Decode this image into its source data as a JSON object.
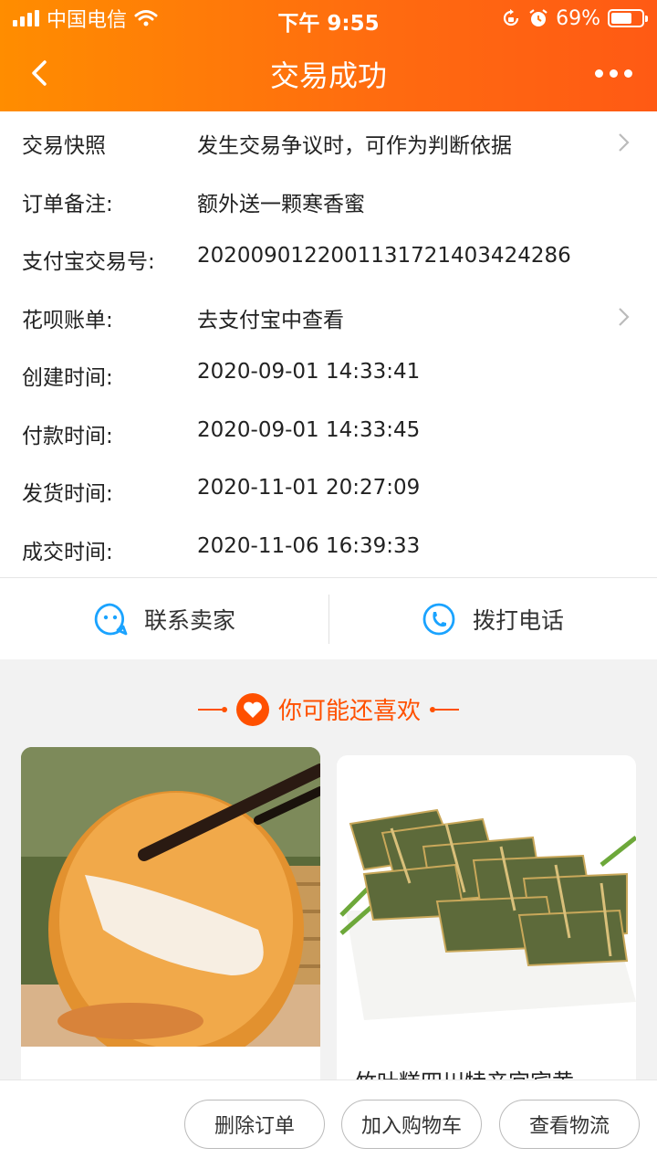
{
  "status_bar": {
    "carrier": "中国电信",
    "time": "下午 9:55",
    "battery_percent": "69%",
    "battery_level": 0.69,
    "icons": [
      "signal-icon",
      "wifi-icon",
      "lock-rotation-icon",
      "alarm-icon",
      "battery-icon"
    ]
  },
  "nav": {
    "title": "交易成功",
    "back_icon": "chevron-left-icon",
    "more_icon": "more-dots-icon"
  },
  "order_info": [
    {
      "label": "交易快照",
      "value": "发生交易争议时，可作为判断依据",
      "has_chevron": true
    },
    {
      "label": "订单备注:",
      "value": "额外送一颗寒香蜜",
      "has_chevron": false
    },
    {
      "label": "支付宝交易号:",
      "value": "2020090122001131721403424286",
      "has_chevron": false
    },
    {
      "label": "花呗账单:",
      "value": "去支付宝中查看",
      "has_chevron": true
    },
    {
      "label": "创建时间:",
      "value": "2020-09-01 14:33:41",
      "has_chevron": false
    },
    {
      "label": "付款时间:",
      "value": "2020-09-01 14:33:45",
      "has_chevron": false
    },
    {
      "label": "发货时间:",
      "value": "2020-11-01 20:27:09",
      "has_chevron": false
    },
    {
      "label": "成交时间:",
      "value": "2020-11-06 16:39:33",
      "has_chevron": false
    }
  ],
  "contact": {
    "seller_label": "联系卖家",
    "call_label": "拨打电话"
  },
  "recommend": {
    "title": "你可能还喜欢",
    "items": [
      {
        "name": ""
      },
      {
        "name": "竹叶糕四川特产宜宾黄"
      }
    ]
  },
  "footer": {
    "delete_label": "删除订单",
    "add_cart_label": "加入购物车",
    "logistics_label": "查看物流"
  },
  "colors": {
    "accent": "#ff5000",
    "header_start": "#ff8d00",
    "header_end": "#ff5a14",
    "icon_blue": "#1aa3ff"
  }
}
